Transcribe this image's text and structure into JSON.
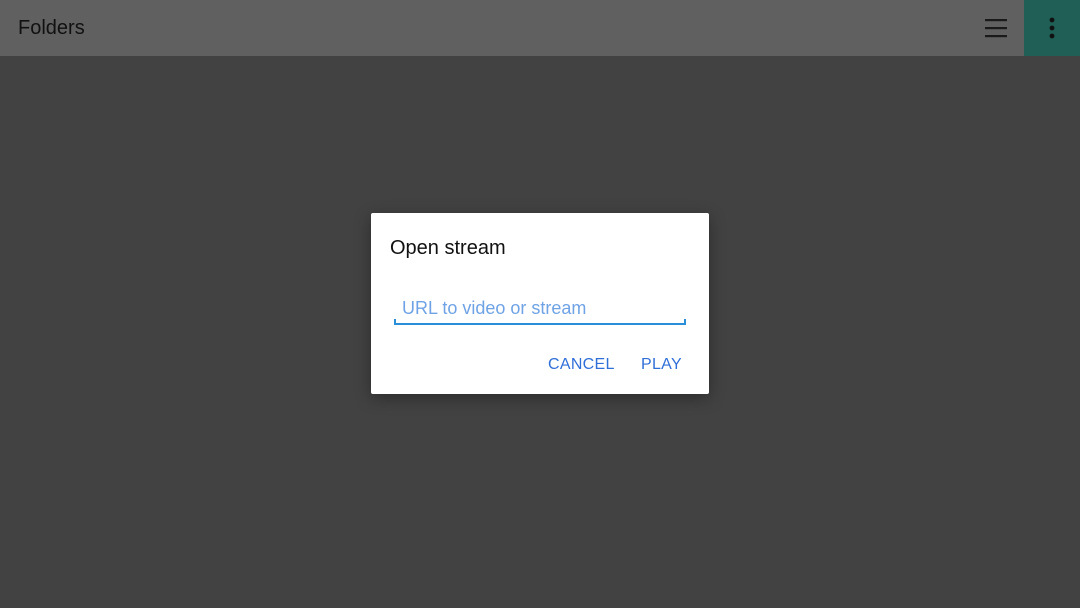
{
  "toolbar": {
    "title": "Folders",
    "menu_icon": "hamburger-menu-icon",
    "overflow_icon": "more-vertical-icon",
    "overflow_bg": "#1f5f55"
  },
  "dialog": {
    "title": "Open stream",
    "url_input": {
      "value": "",
      "placeholder": "URL to video or stream"
    },
    "cancel_label": "CANCEL",
    "play_label": "PLAY",
    "accent_color": "#2f6fd8"
  }
}
